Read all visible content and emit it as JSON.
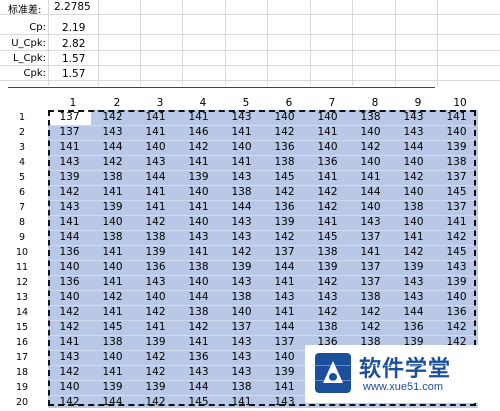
{
  "stats": {
    "std_label": "标准差:",
    "std_value": "2.2785",
    "rows": [
      {
        "label": "Cp:",
        "value": "2.19"
      },
      {
        "label": "U_Cpk:",
        "value": "2.82"
      },
      {
        "label": "L_Cpk:",
        "value": "1.57"
      },
      {
        "label": "Cpk:",
        "value": "1.57"
      }
    ]
  },
  "columns": [
    "1",
    "2",
    "3",
    "4",
    "5",
    "6",
    "7",
    "8",
    "9",
    "10"
  ],
  "rows": [
    "1",
    "2",
    "3",
    "4",
    "5",
    "6",
    "7",
    "8",
    "9",
    "10",
    "11",
    "12",
    "13",
    "14",
    "15",
    "16",
    "17",
    "18",
    "19",
    "20"
  ],
  "table": [
    [
      "137",
      "142",
      "141",
      "141",
      "143",
      "140",
      "140",
      "138",
      "143",
      "141"
    ],
    [
      "137",
      "143",
      "141",
      "146",
      "141",
      "142",
      "141",
      "140",
      "143",
      "140"
    ],
    [
      "141",
      "144",
      "140",
      "142",
      "140",
      "136",
      "140",
      "142",
      "144",
      "139"
    ],
    [
      "143",
      "142",
      "143",
      "141",
      "141",
      "138",
      "136",
      "140",
      "140",
      "138"
    ],
    [
      "139",
      "138",
      "144",
      "139",
      "143",
      "145",
      "141",
      "141",
      "142",
      "137"
    ],
    [
      "142",
      "141",
      "141",
      "140",
      "138",
      "142",
      "142",
      "144",
      "140",
      "145"
    ],
    [
      "143",
      "139",
      "141",
      "141",
      "144",
      "136",
      "142",
      "140",
      "138",
      "137"
    ],
    [
      "141",
      "140",
      "142",
      "140",
      "143",
      "139",
      "141",
      "143",
      "140",
      "141"
    ],
    [
      "144",
      "138",
      "138",
      "143",
      "143",
      "142",
      "145",
      "137",
      "141",
      "142"
    ],
    [
      "136",
      "141",
      "139",
      "141",
      "142",
      "137",
      "138",
      "141",
      "142",
      "145"
    ],
    [
      "140",
      "140",
      "136",
      "138",
      "139",
      "144",
      "139",
      "137",
      "139",
      "143"
    ],
    [
      "136",
      "141",
      "143",
      "140",
      "143",
      "141",
      "142",
      "137",
      "143",
      "139"
    ],
    [
      "140",
      "142",
      "140",
      "144",
      "138",
      "143",
      "143",
      "138",
      "143",
      "140"
    ],
    [
      "142",
      "141",
      "142",
      "138",
      "140",
      "141",
      "142",
      "142",
      "144",
      "136"
    ],
    [
      "142",
      "145",
      "141",
      "142",
      "137",
      "144",
      "138",
      "142",
      "136",
      "142"
    ],
    [
      "141",
      "138",
      "139",
      "141",
      "143",
      "137",
      "136",
      "138",
      "139",
      "142"
    ],
    [
      "143",
      "140",
      "142",
      "136",
      "143",
      "140",
      "",
      "",
      "",
      ""
    ],
    [
      "142",
      "141",
      "142",
      "143",
      "143",
      "139",
      "",
      "",
      "",
      ""
    ],
    [
      "140",
      "139",
      "139",
      "144",
      "138",
      "141",
      "",
      "",
      "",
      ""
    ],
    [
      "142",
      "144",
      "142",
      "145",
      "141",
      "143",
      "",
      "",
      "",
      ""
    ]
  ],
  "watermark": {
    "title": "软件学堂",
    "url": "www.xue51.com",
    "colors": {
      "brand": "#1b4f9c"
    }
  },
  "colors": {
    "selection": "#b8c8e6",
    "gridline": "#d9d9d9"
  }
}
